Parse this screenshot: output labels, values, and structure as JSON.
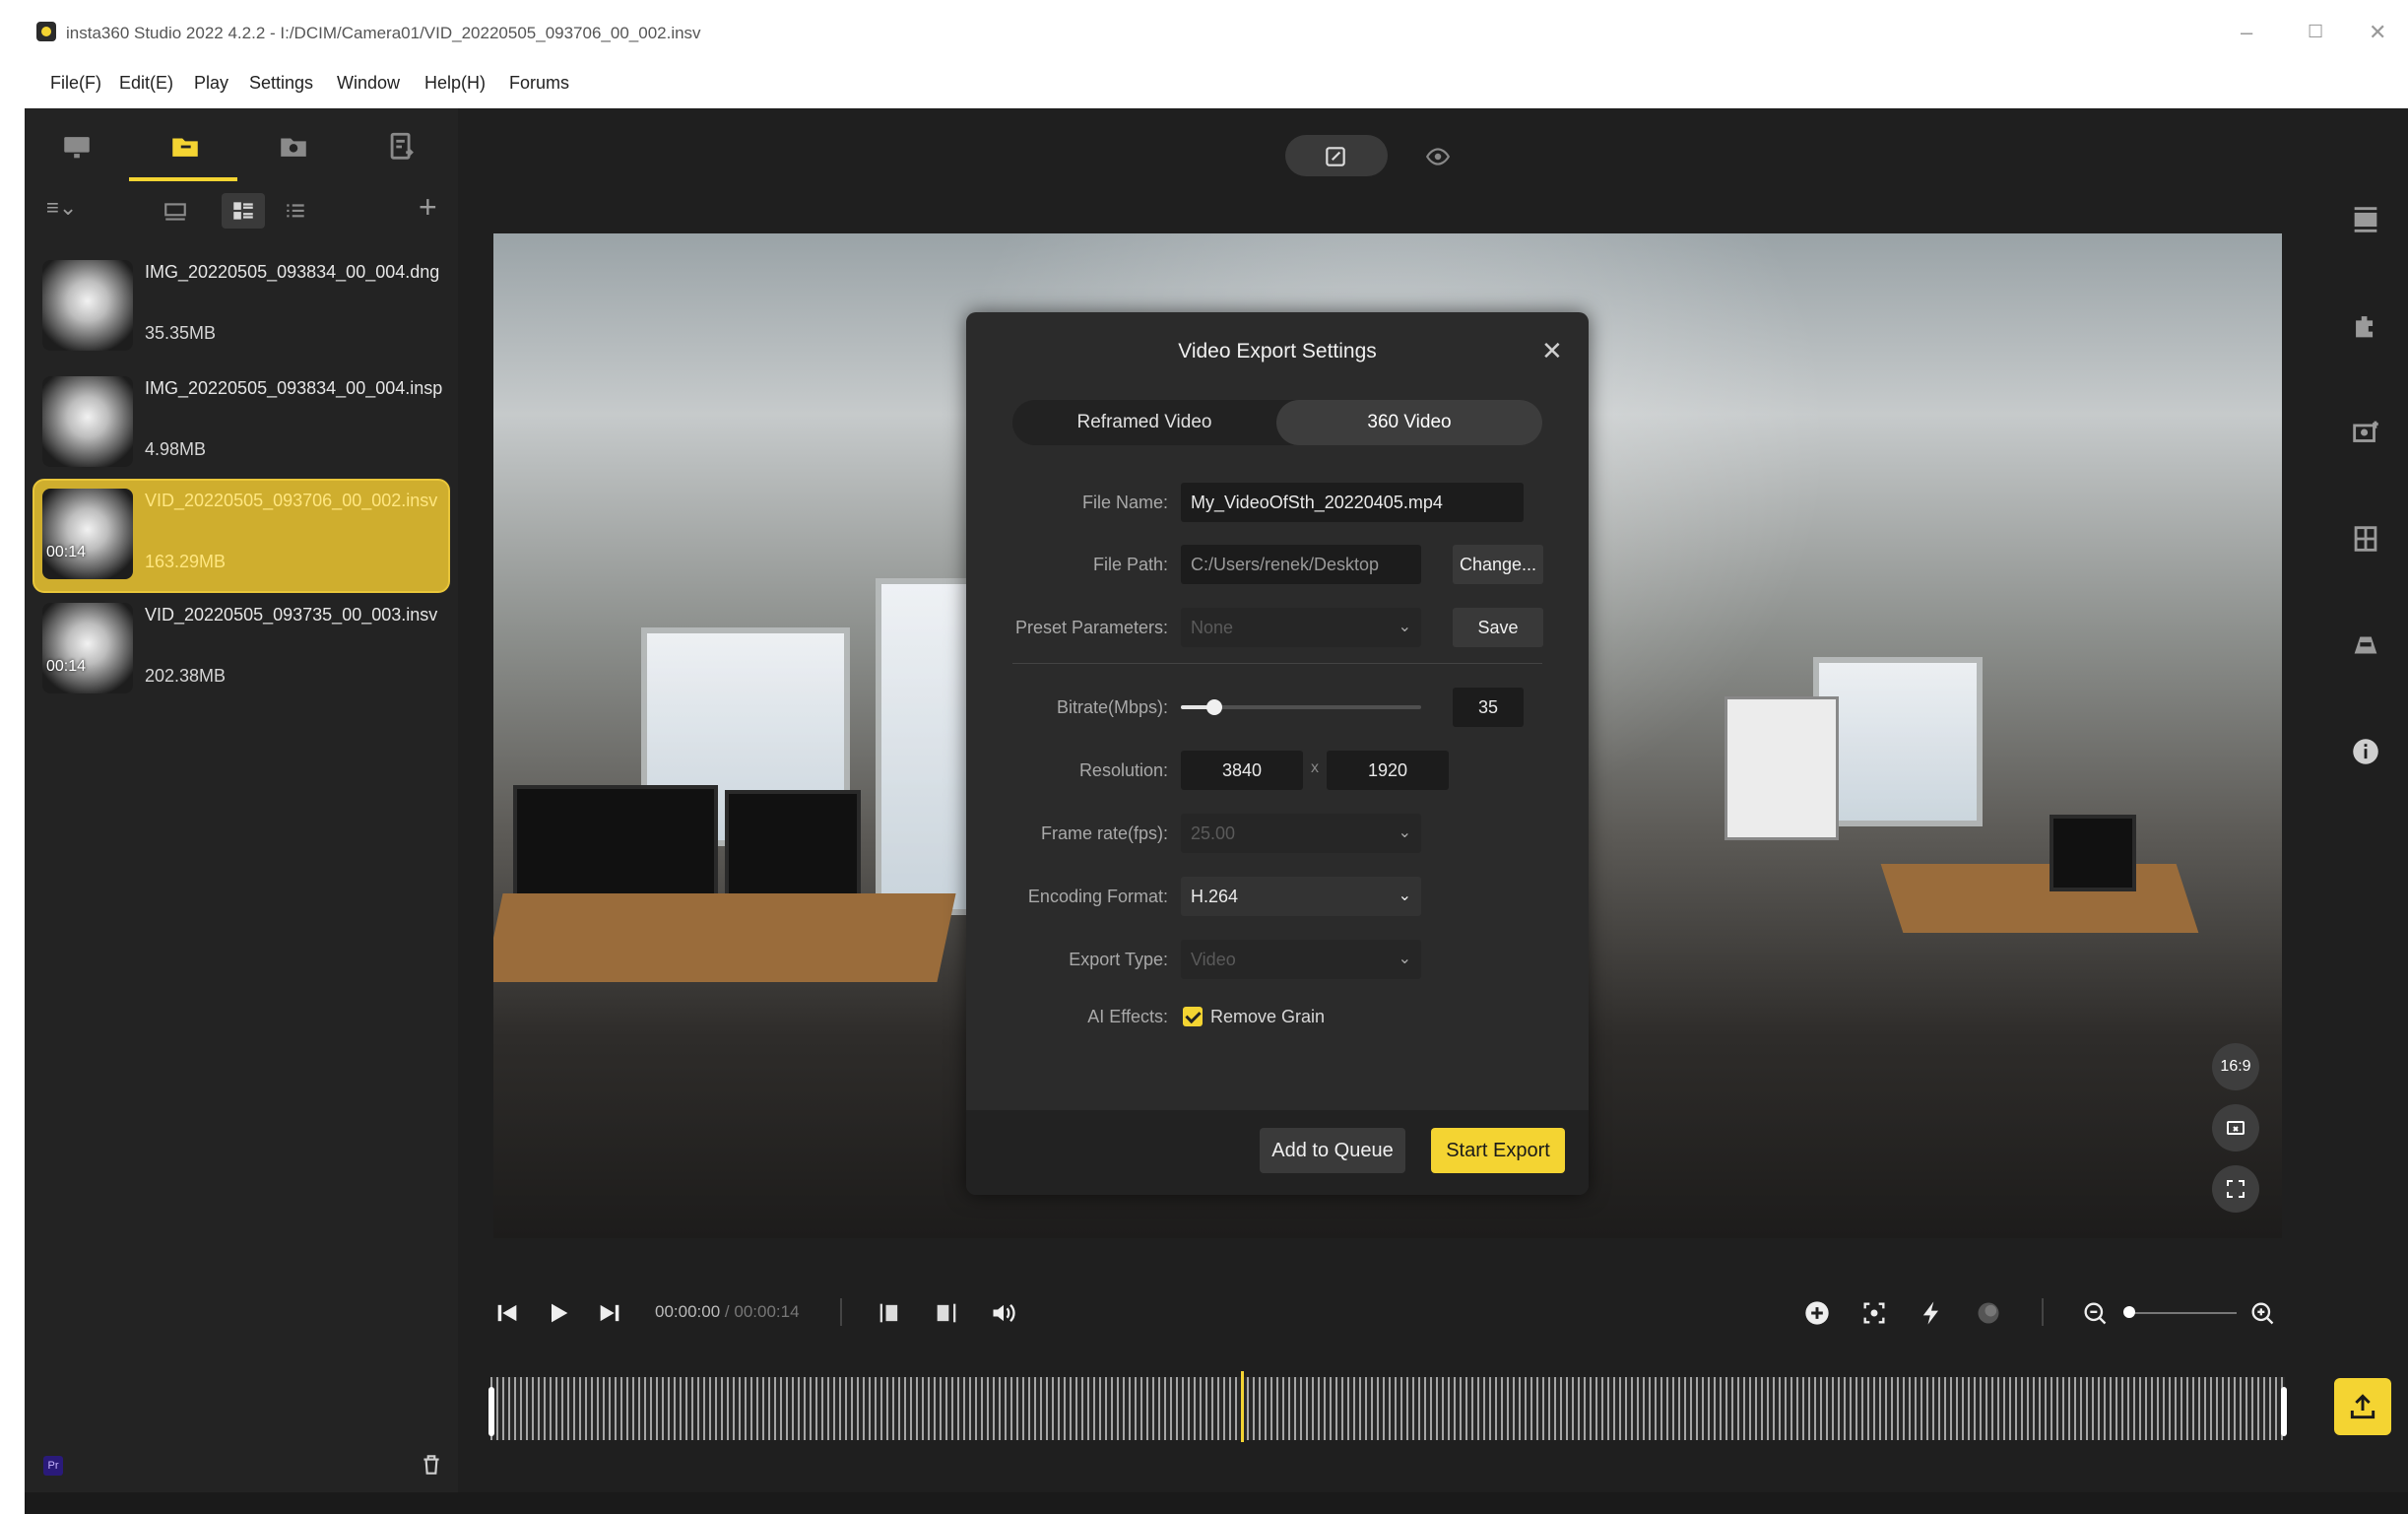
{
  "window": {
    "title": "insta360 Studio 2022 4.2.2 - I:/DCIM/Camera01/VID_20220505_093706_00_002.insv",
    "controls": {
      "minimize": "–",
      "maximize": "☐",
      "close": "✕"
    }
  },
  "menu": [
    "File(F)",
    "Edit(E)",
    "Play",
    "Settings",
    "Window",
    "Help(H)",
    "Forums"
  ],
  "sidebar": {
    "tabs": [
      {
        "icon": "monitor-icon"
      },
      {
        "icon": "folder-file-icon",
        "active": true
      },
      {
        "icon": "camera-folder-icon"
      },
      {
        "icon": "export-list-icon"
      }
    ],
    "toolbar": {
      "sort_icon": "≡⌄",
      "add": "+"
    },
    "files": [
      {
        "name": "IMG_20220505_093834_00_004.dng",
        "size": "35.35MB",
        "duration": ""
      },
      {
        "name": "IMG_20220505_093834_00_004.insp",
        "size": "4.98MB",
        "duration": ""
      },
      {
        "name": "VID_20220505_093706_00_002.insv",
        "size": "163.29MB",
        "duration": "00:14",
        "selected": true
      },
      {
        "name": "VID_20220505_093735_00_003.insv",
        "size": "202.38MB",
        "duration": "00:14"
      }
    ]
  },
  "viewer": {
    "aspect_ratio": "16:9"
  },
  "dialog": {
    "title": "Video Export Settings",
    "close": "✕",
    "tabs": [
      "Reframed Video",
      "360 Video"
    ],
    "active_tab": "360 Video",
    "file_name_label": "File Name:",
    "file_name": "My_VideoOfSth_20220405.mp4",
    "file_path_label": "File Path:",
    "file_path": "C:/Users/renek/Desktop",
    "change_button": "Change...",
    "preset_label": "Preset Parameters:",
    "preset_value": "None",
    "save_button": "Save",
    "bitrate_label": "Bitrate(Mbps):",
    "bitrate_value": "35",
    "bitrate_fraction": 0.14,
    "resolution_label": "Resolution:",
    "res_width": "3840",
    "res_x": "x",
    "res_height": "1920",
    "framerate_label": "Frame rate(fps):",
    "framerate_value": "25.00",
    "encoding_label": "Encoding Format:",
    "encoding_value": "H.264",
    "export_type_label": "Export Type:",
    "export_type_value": "Video",
    "ai_label": "AI Effects:",
    "ai_option": "Remove Grain",
    "ai_checked": true,
    "add_queue_button": "Add to Queue",
    "start_export_button": "Start Export"
  },
  "playback": {
    "current_time": "00:00:00",
    "total_time": "/ 00:00:14",
    "zoom_fraction": 0.0
  },
  "colors": {
    "accent": "#f4d432",
    "panel": "#232323",
    "dialog": "#2b2b2b"
  }
}
